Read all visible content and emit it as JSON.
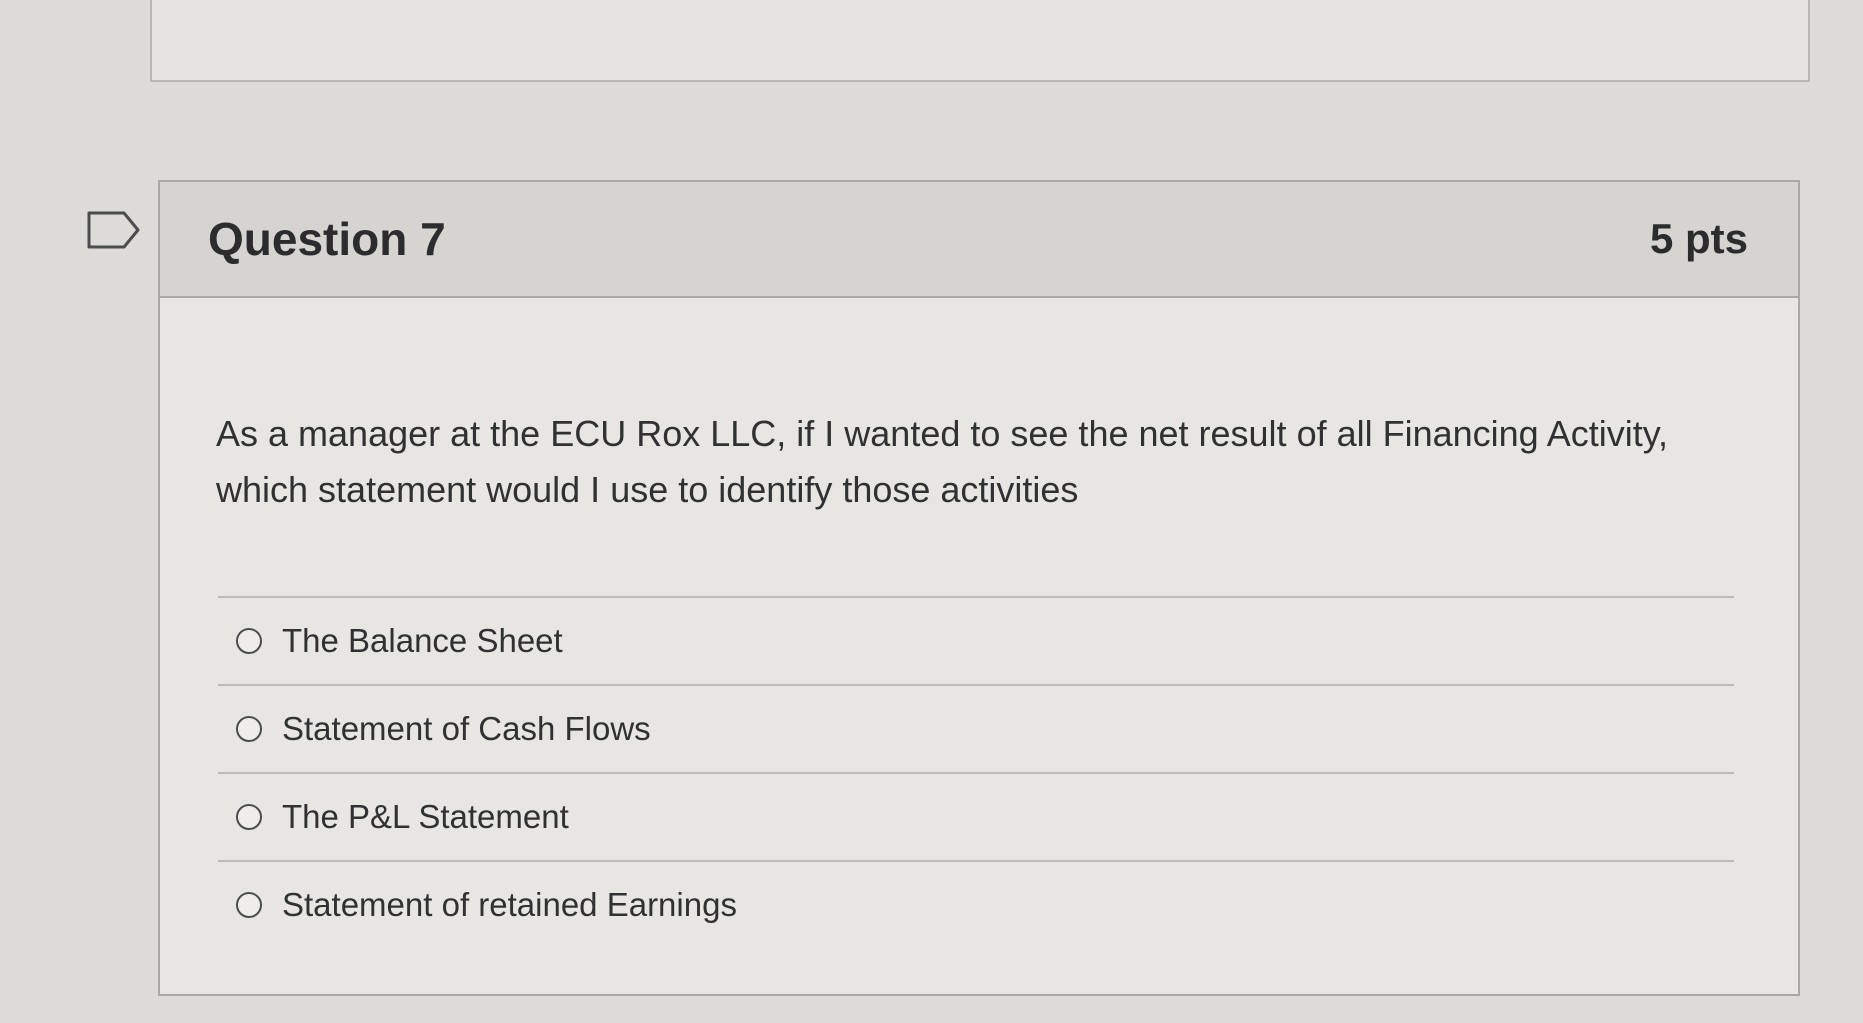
{
  "question": {
    "title": "Question 7",
    "points": "5 pts",
    "text": "As a manager at the ECU Rox LLC, if I wanted to see the net result of all Financing Activity, which statement would I use to identify those activities",
    "answers": [
      {
        "label": "The Balance Sheet",
        "selected": false
      },
      {
        "label": "Statement of Cash Flows",
        "selected": false
      },
      {
        "label": "The P&L Statement",
        "selected": false
      },
      {
        "label": "Statement of retained Earnings",
        "selected": false
      }
    ]
  },
  "icons": {
    "flag": "flag-icon",
    "radio": "radio-button-icon"
  },
  "colors": {
    "header_bg": "#d5d4d0",
    "card_bg": "#e7e6e2",
    "text": "#2f3133"
  }
}
